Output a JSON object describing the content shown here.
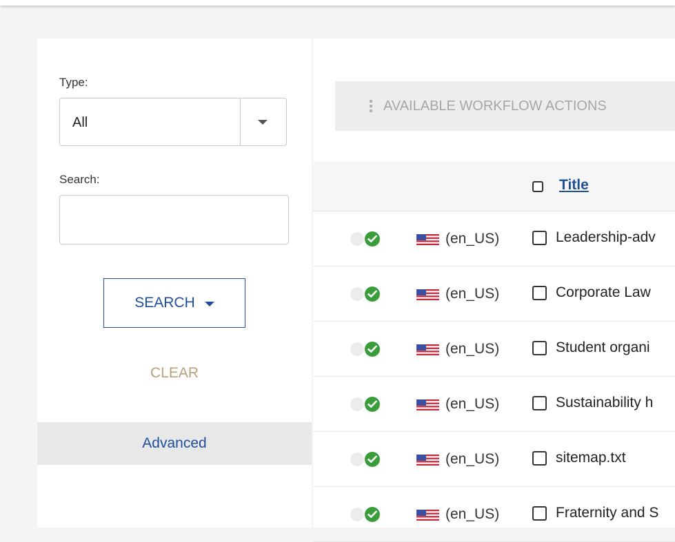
{
  "filters": {
    "type_label": "Type:",
    "type_value": "All",
    "search_label": "Search:",
    "search_value": "",
    "search_button": "SEARCH",
    "clear_button": "CLEAR",
    "advanced_link": "Advanced"
  },
  "toolbar": {
    "workflow_actions": "AVAILABLE WORKFLOW ACTIONS"
  },
  "table": {
    "header_title": "Title",
    "rows": [
      {
        "locale": "(en_US)",
        "title": "Leadership-adv"
      },
      {
        "locale": "(en_US)",
        "title": "Corporate Law"
      },
      {
        "locale": "(en_US)",
        "title": "Student organi"
      },
      {
        "locale": "(en_US)",
        "title": "Sustainability h"
      },
      {
        "locale": "(en_US)",
        "title": "sitemap.txt"
      },
      {
        "locale": "(en_US)",
        "title": "Fraternity and S"
      }
    ]
  },
  "colors": {
    "accent": "#1f4e9a",
    "status_ok": "#3a9c3a",
    "clear_text": "#b5a27a"
  },
  "icons": {
    "status_inactive": "grey-dot-icon",
    "status_published": "green-check-icon",
    "locale_flag": "us-flag-icon",
    "dropdown": "caret-down-icon",
    "kebab": "vertical-ellipsis-icon"
  }
}
